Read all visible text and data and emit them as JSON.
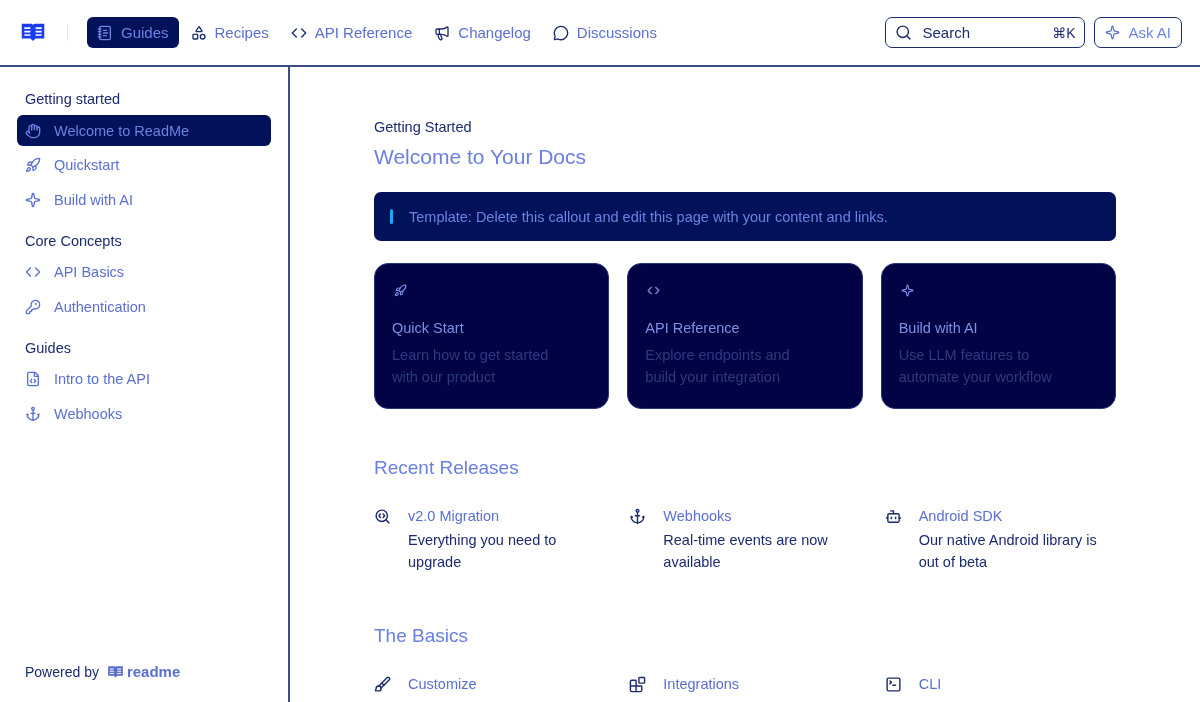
{
  "header": {
    "tabs": [
      {
        "label": "Guides",
        "selected": true
      },
      {
        "label": "Recipes",
        "selected": false
      },
      {
        "label": "API Reference",
        "selected": false
      },
      {
        "label": "Changelog",
        "selected": false
      },
      {
        "label": "Discussions",
        "selected": false
      }
    ],
    "search": {
      "placeholder": "Search",
      "shortcut": "⌘K"
    },
    "ask_ai": "Ask AI"
  },
  "sidebar": {
    "sections": [
      {
        "title": "Getting started",
        "items": [
          {
            "label": "Welcome to ReadMe",
            "selected": true
          },
          {
            "label": "Quickstart",
            "selected": false
          },
          {
            "label": "Build with AI",
            "selected": false
          }
        ]
      },
      {
        "title": "Core Concepts",
        "items": [
          {
            "label": "API Basics",
            "selected": false
          },
          {
            "label": "Authentication",
            "selected": false
          }
        ]
      },
      {
        "title": "Guides",
        "items": [
          {
            "label": "Intro to the API",
            "selected": false
          },
          {
            "label": "Webhooks",
            "selected": false
          }
        ]
      }
    ],
    "powered_by": "Powered by",
    "brand": "readme"
  },
  "page": {
    "breadcrumb": "Getting Started",
    "title": "Welcome to Your Docs",
    "callout": "Template: Delete this callout and edit this page with your content and links.",
    "cards": [
      {
        "title": "Quick Start",
        "description": "Learn how to get started with our product"
      },
      {
        "title": "API Reference",
        "description": "Explore endpoints and build your integration"
      },
      {
        "title": "Build with AI",
        "description": "Use LLM features to automate your workflow"
      }
    ],
    "sections": [
      {
        "heading": "Recent Releases",
        "items": [
          {
            "title": "v2.0 Migration",
            "description": "Everything you need to upgrade"
          },
          {
            "title": "Webhooks",
            "description": "Real-time events are now available"
          },
          {
            "title": "Android SDK",
            "description": "Our native Android library is out of beta"
          }
        ]
      },
      {
        "heading": "The Basics",
        "items": [
          {
            "title": "Customize"
          },
          {
            "title": "Integrations"
          },
          {
            "title": "CLI"
          }
        ]
      }
    ]
  }
}
